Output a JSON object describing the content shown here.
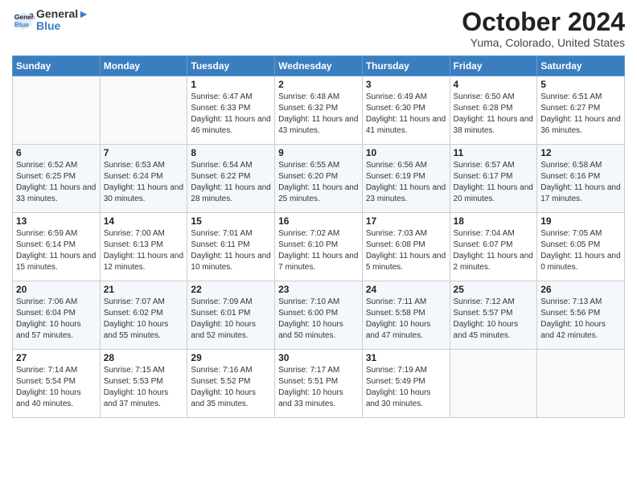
{
  "header": {
    "logo_line1": "General",
    "logo_line2": "Blue",
    "month": "October 2024",
    "location": "Yuma, Colorado, United States"
  },
  "days_of_week": [
    "Sunday",
    "Monday",
    "Tuesday",
    "Wednesday",
    "Thursday",
    "Friday",
    "Saturday"
  ],
  "weeks": [
    [
      {
        "day": "",
        "info": ""
      },
      {
        "day": "",
        "info": ""
      },
      {
        "day": "1",
        "info": "Sunrise: 6:47 AM\nSunset: 6:33 PM\nDaylight: 11 hours and 46 minutes."
      },
      {
        "day": "2",
        "info": "Sunrise: 6:48 AM\nSunset: 6:32 PM\nDaylight: 11 hours and 43 minutes."
      },
      {
        "day": "3",
        "info": "Sunrise: 6:49 AM\nSunset: 6:30 PM\nDaylight: 11 hours and 41 minutes."
      },
      {
        "day": "4",
        "info": "Sunrise: 6:50 AM\nSunset: 6:28 PM\nDaylight: 11 hours and 38 minutes."
      },
      {
        "day": "5",
        "info": "Sunrise: 6:51 AM\nSunset: 6:27 PM\nDaylight: 11 hours and 36 minutes."
      }
    ],
    [
      {
        "day": "6",
        "info": "Sunrise: 6:52 AM\nSunset: 6:25 PM\nDaylight: 11 hours and 33 minutes."
      },
      {
        "day": "7",
        "info": "Sunrise: 6:53 AM\nSunset: 6:24 PM\nDaylight: 11 hours and 30 minutes."
      },
      {
        "day": "8",
        "info": "Sunrise: 6:54 AM\nSunset: 6:22 PM\nDaylight: 11 hours and 28 minutes."
      },
      {
        "day": "9",
        "info": "Sunrise: 6:55 AM\nSunset: 6:20 PM\nDaylight: 11 hours and 25 minutes."
      },
      {
        "day": "10",
        "info": "Sunrise: 6:56 AM\nSunset: 6:19 PM\nDaylight: 11 hours and 23 minutes."
      },
      {
        "day": "11",
        "info": "Sunrise: 6:57 AM\nSunset: 6:17 PM\nDaylight: 11 hours and 20 minutes."
      },
      {
        "day": "12",
        "info": "Sunrise: 6:58 AM\nSunset: 6:16 PM\nDaylight: 11 hours and 17 minutes."
      }
    ],
    [
      {
        "day": "13",
        "info": "Sunrise: 6:59 AM\nSunset: 6:14 PM\nDaylight: 11 hours and 15 minutes."
      },
      {
        "day": "14",
        "info": "Sunrise: 7:00 AM\nSunset: 6:13 PM\nDaylight: 11 hours and 12 minutes."
      },
      {
        "day": "15",
        "info": "Sunrise: 7:01 AM\nSunset: 6:11 PM\nDaylight: 11 hours and 10 minutes."
      },
      {
        "day": "16",
        "info": "Sunrise: 7:02 AM\nSunset: 6:10 PM\nDaylight: 11 hours and 7 minutes."
      },
      {
        "day": "17",
        "info": "Sunrise: 7:03 AM\nSunset: 6:08 PM\nDaylight: 11 hours and 5 minutes."
      },
      {
        "day": "18",
        "info": "Sunrise: 7:04 AM\nSunset: 6:07 PM\nDaylight: 11 hours and 2 minutes."
      },
      {
        "day": "19",
        "info": "Sunrise: 7:05 AM\nSunset: 6:05 PM\nDaylight: 11 hours and 0 minutes."
      }
    ],
    [
      {
        "day": "20",
        "info": "Sunrise: 7:06 AM\nSunset: 6:04 PM\nDaylight: 10 hours and 57 minutes."
      },
      {
        "day": "21",
        "info": "Sunrise: 7:07 AM\nSunset: 6:02 PM\nDaylight: 10 hours and 55 minutes."
      },
      {
        "day": "22",
        "info": "Sunrise: 7:09 AM\nSunset: 6:01 PM\nDaylight: 10 hours and 52 minutes."
      },
      {
        "day": "23",
        "info": "Sunrise: 7:10 AM\nSunset: 6:00 PM\nDaylight: 10 hours and 50 minutes."
      },
      {
        "day": "24",
        "info": "Sunrise: 7:11 AM\nSunset: 5:58 PM\nDaylight: 10 hours and 47 minutes."
      },
      {
        "day": "25",
        "info": "Sunrise: 7:12 AM\nSunset: 5:57 PM\nDaylight: 10 hours and 45 minutes."
      },
      {
        "day": "26",
        "info": "Sunrise: 7:13 AM\nSunset: 5:56 PM\nDaylight: 10 hours and 42 minutes."
      }
    ],
    [
      {
        "day": "27",
        "info": "Sunrise: 7:14 AM\nSunset: 5:54 PM\nDaylight: 10 hours and 40 minutes."
      },
      {
        "day": "28",
        "info": "Sunrise: 7:15 AM\nSunset: 5:53 PM\nDaylight: 10 hours and 37 minutes."
      },
      {
        "day": "29",
        "info": "Sunrise: 7:16 AM\nSunset: 5:52 PM\nDaylight: 10 hours and 35 minutes."
      },
      {
        "day": "30",
        "info": "Sunrise: 7:17 AM\nSunset: 5:51 PM\nDaylight: 10 hours and 33 minutes."
      },
      {
        "day": "31",
        "info": "Sunrise: 7:19 AM\nSunset: 5:49 PM\nDaylight: 10 hours and 30 minutes."
      },
      {
        "day": "",
        "info": ""
      },
      {
        "day": "",
        "info": ""
      }
    ]
  ]
}
